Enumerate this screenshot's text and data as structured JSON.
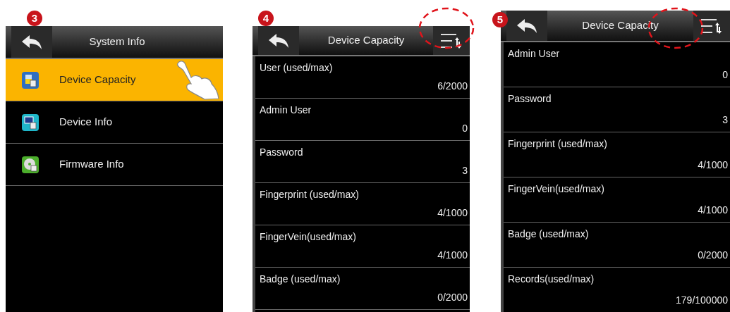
{
  "screens": [
    {
      "kind": "menu",
      "step": "3",
      "title": "System Info",
      "items": [
        {
          "label": "Device Capacity",
          "selected": true
        },
        {
          "label": "Device Info",
          "selected": false
        },
        {
          "label": "Firmware Info",
          "selected": false
        }
      ]
    },
    {
      "kind": "list",
      "step": "4",
      "title": "Device Capacity",
      "rows": [
        {
          "label": "User (used/max)",
          "value": "6/2000"
        },
        {
          "label": "Admin User",
          "value": "0"
        },
        {
          "label": "Password",
          "value": "3"
        },
        {
          "label": "Fingerprint (used/max)",
          "value": "4/1000"
        },
        {
          "label": "FingerVein(used/max)",
          "value": "4/1000"
        },
        {
          "label": "Badge (used/max)",
          "value": "0/2000"
        }
      ]
    },
    {
      "kind": "list",
      "step": "5",
      "title": "Device Capacity",
      "rows": [
        {
          "label": "Admin User",
          "value": "0"
        },
        {
          "label": "Password",
          "value": "3"
        },
        {
          "label": "Fingerprint (used/max)",
          "value": "4/1000"
        },
        {
          "label": "FingerVein(used/max)",
          "value": "4/1000"
        },
        {
          "label": "Badge (used/max)",
          "value": "0/2000"
        },
        {
          "label": "Records(used/max)",
          "value": "179/100000"
        }
      ]
    }
  ]
}
